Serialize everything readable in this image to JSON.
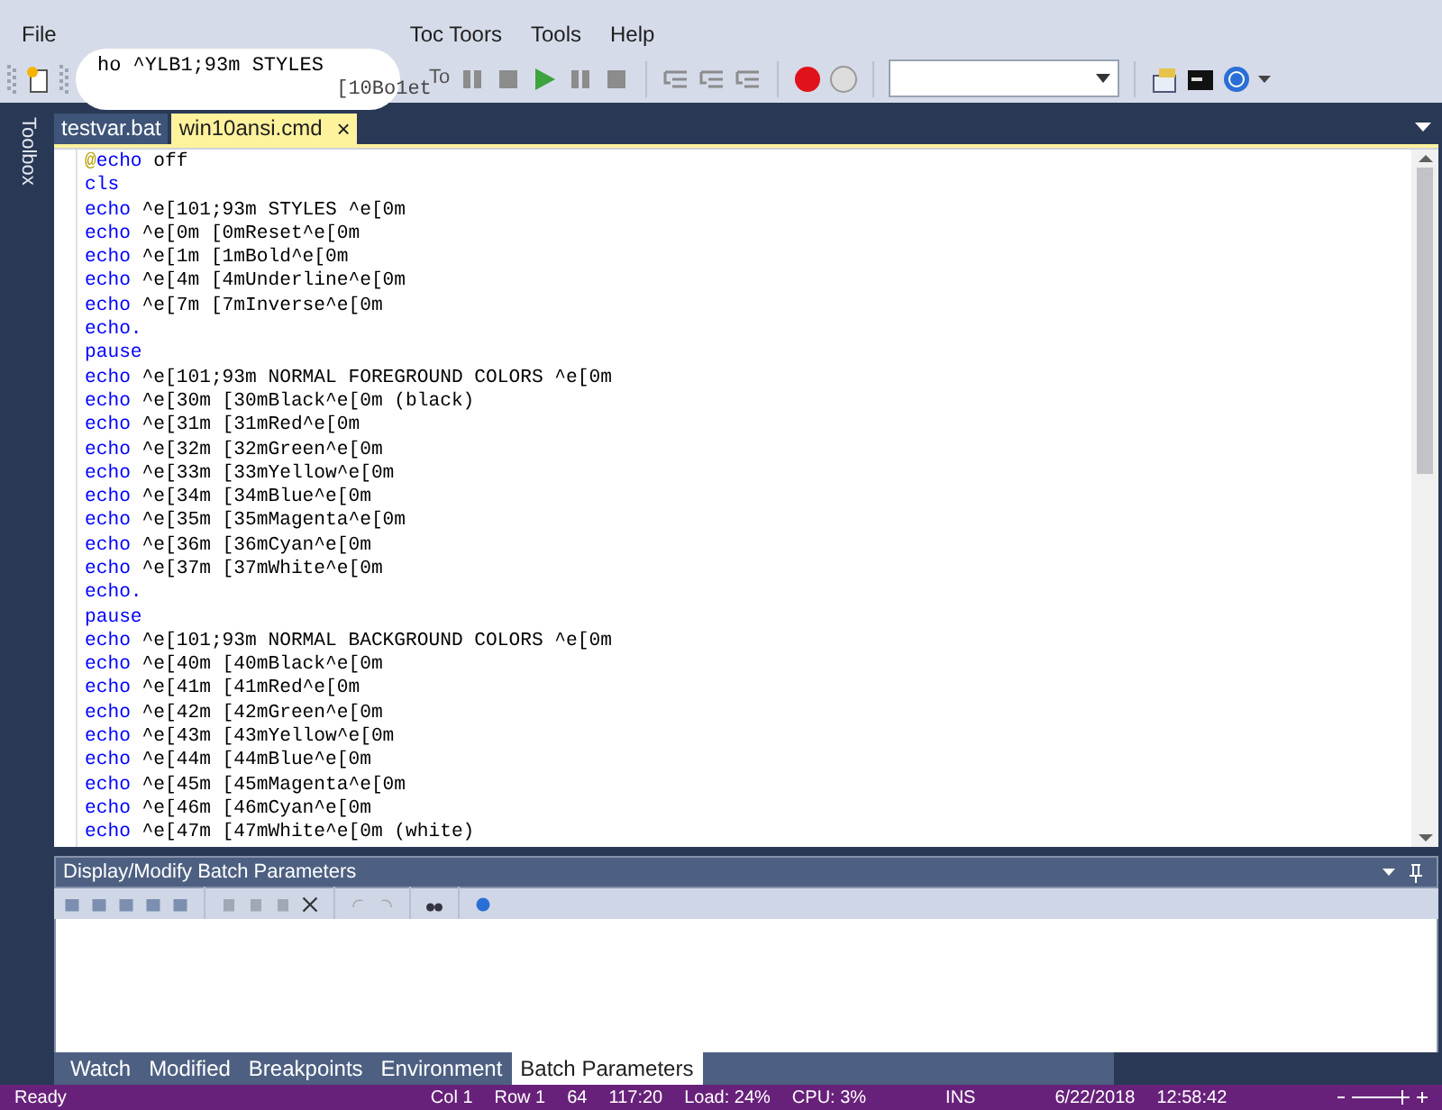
{
  "menu": [
    {
      "label": "File"
    },
    {
      "label": "Toc Toors"
    },
    {
      "label": "Tools"
    },
    {
      "label": "Help"
    }
  ],
  "overlay_text": [
    "ho ^YLB1;93m STYLES",
    "[10Bo1et"
  ],
  "toolbar": {
    "fragment": "To"
  },
  "side_tab": "Toolbox",
  "doc_tabs": [
    {
      "label": "testvar.bat",
      "selected": false
    },
    {
      "label": "win10ansi.cmd",
      "selected": true,
      "close": "×"
    }
  ],
  "code_lines": [
    {
      "prefix": "@",
      "keyword": "echo",
      "rest": " off"
    },
    {
      "keyword": "cls"
    },
    {
      "keyword": "echo",
      "rest": " ^e[101;93m STYLES ^e[0m"
    },
    {
      "keyword": "echo",
      "rest": " ^e[0m [0mReset^e[0m"
    },
    {
      "keyword": "echo",
      "rest": " ^e[1m [1mBold^e[0m"
    },
    {
      "keyword": "echo",
      "rest": " ^e[4m [4mUnderline^e[0m"
    },
    {
      "keyword": "echo",
      "rest": " ^e[7m [7mInverse^e[0m"
    },
    {
      "keyword": "echo."
    },
    {
      "keyword": "pause"
    },
    {
      "keyword": "echo",
      "rest": " ^e[101;93m NORMAL FOREGROUND COLORS ^e[0m"
    },
    {
      "keyword": "echo",
      "rest": " ^e[30m [30mBlack^e[0m (black)"
    },
    {
      "keyword": "echo",
      "rest": " ^e[31m [31mRed^e[0m"
    },
    {
      "keyword": "echo",
      "rest": " ^e[32m [32mGreen^e[0m"
    },
    {
      "keyword": "echo",
      "rest": " ^e[33m [33mYellow^e[0m"
    },
    {
      "keyword": "echo",
      "rest": " ^e[34m [34mBlue^e[0m"
    },
    {
      "keyword": "echo",
      "rest": " ^e[35m [35mMagenta^e[0m"
    },
    {
      "keyword": "echo",
      "rest": " ^e[36m [36mCyan^e[0m"
    },
    {
      "keyword": "echo",
      "rest": " ^e[37m [37mWhite^e[0m"
    },
    {
      "keyword": "echo."
    },
    {
      "keyword": "pause"
    },
    {
      "keyword": "echo",
      "rest": " ^e[101;93m NORMAL BACKGROUND COLORS ^e[0m"
    },
    {
      "keyword": "echo",
      "rest": " ^e[40m [40mBlack^e[0m"
    },
    {
      "keyword": "echo",
      "rest": " ^e[41m [41mRed^e[0m"
    },
    {
      "keyword": "echo",
      "rest": " ^e[42m [42mGreen^e[0m"
    },
    {
      "keyword": "echo",
      "rest": " ^e[43m [43mYellow^e[0m"
    },
    {
      "keyword": "echo",
      "rest": " ^e[44m [44mBlue^e[0m"
    },
    {
      "keyword": "echo",
      "rest": " ^e[45m [45mMagenta^e[0m"
    },
    {
      "keyword": "echo",
      "rest": " ^e[46m [46mCyan^e[0m"
    },
    {
      "keyword": "echo",
      "rest": " ^e[47m [47mWhite^e[0m (white)"
    }
  ],
  "panel": {
    "title": "Display/Modify Batch Parameters",
    "tabs": [
      {
        "label": "Watch",
        "selected": false
      },
      {
        "label": "Modified",
        "selected": false
      },
      {
        "label": "Breakpoints",
        "selected": false
      },
      {
        "label": "Environment",
        "selected": false
      },
      {
        "label": "Batch Parameters",
        "selected": true
      }
    ]
  },
  "status_bar": {
    "left": "Ready",
    "items": [
      "Col 1",
      "Row 1",
      "64",
      "117:20",
      "Load: 24%",
      "CPU: 3%",
      "INS",
      "6/22/2018",
      "12:58:42"
    ]
  }
}
